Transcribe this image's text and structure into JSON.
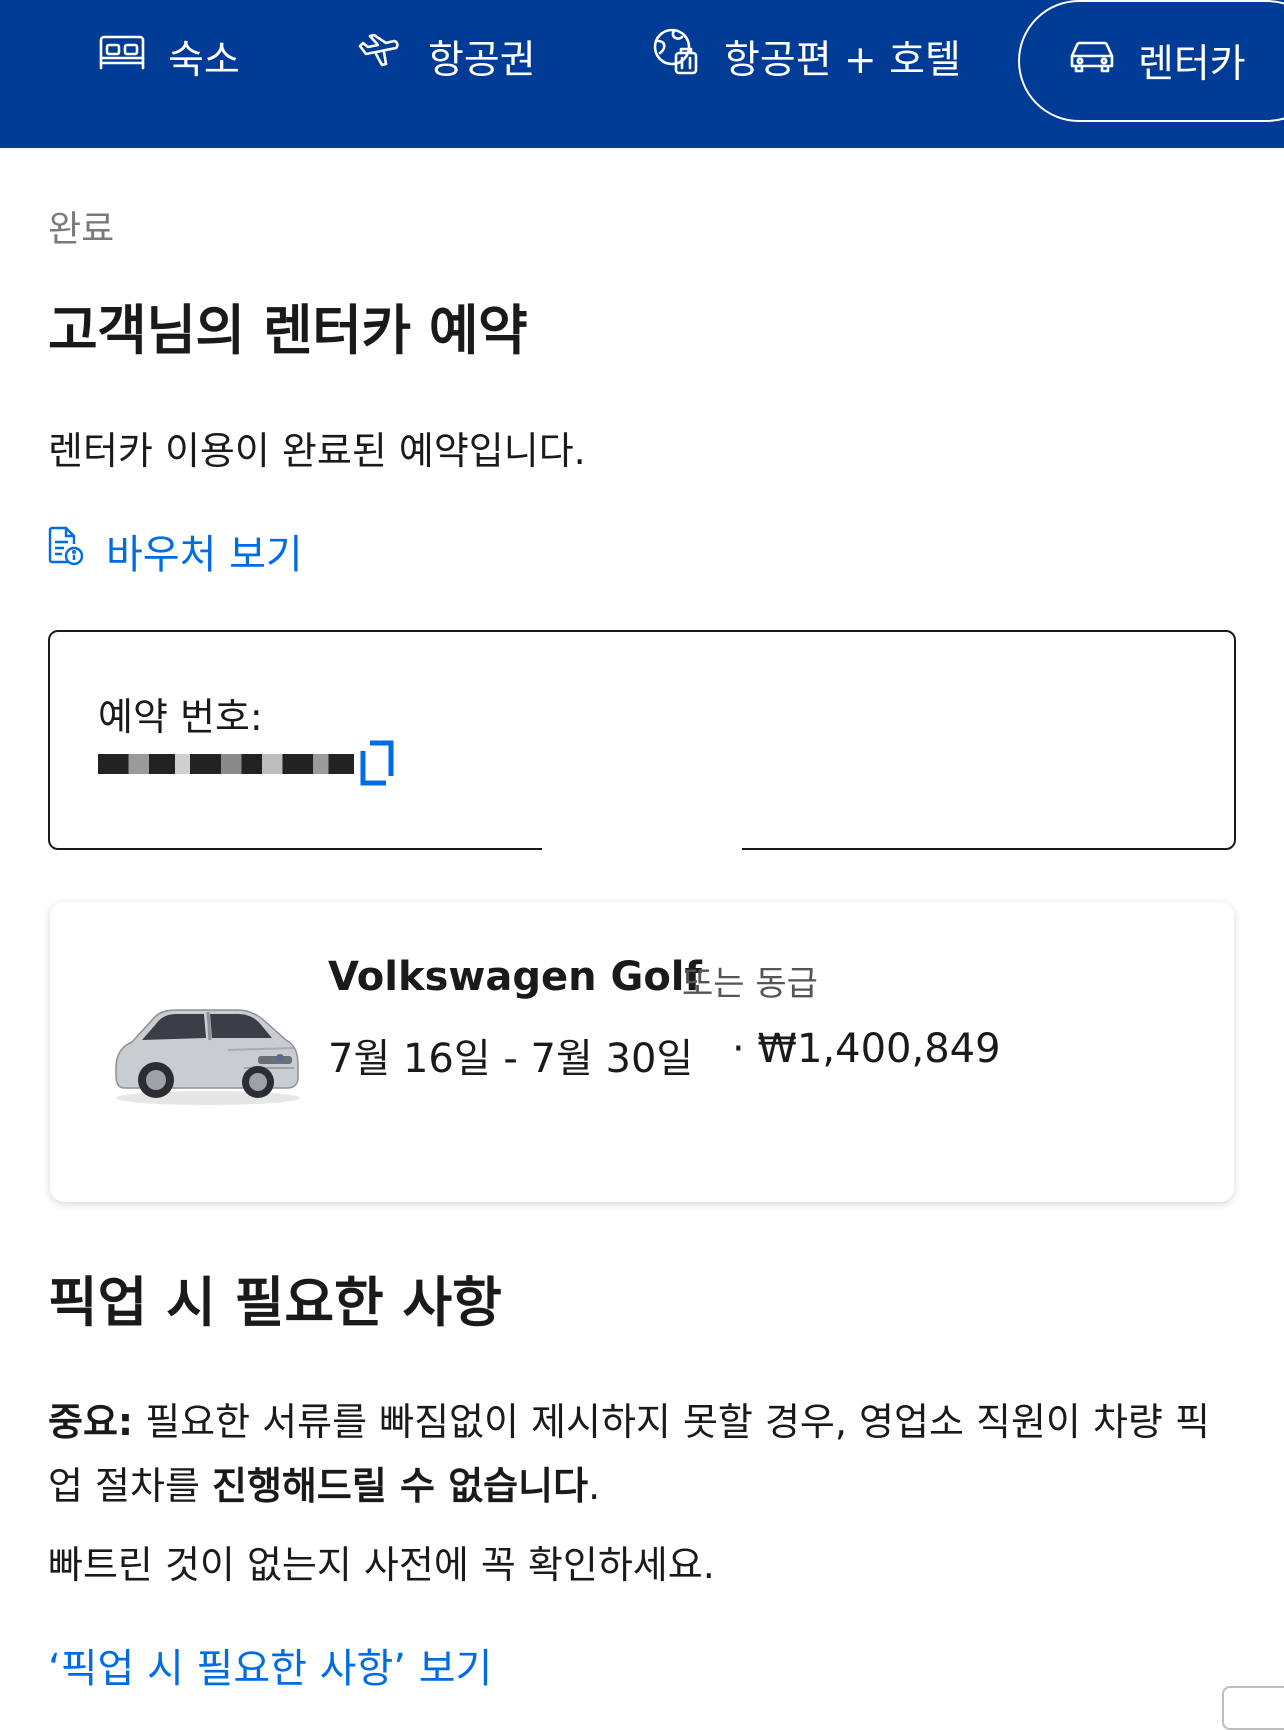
{
  "nav": {
    "items": [
      {
        "label": "숙소",
        "icon": "bed-icon"
      },
      {
        "label": "항공권",
        "icon": "airplane-icon"
      },
      {
        "label": "항공편 + 호텔",
        "icon": "globe-luggage-icon"
      },
      {
        "label": "렌터카",
        "icon": "car-icon",
        "active": true
      }
    ]
  },
  "breadcrumb": "완료",
  "page_title": "고객님의 렌터카 예약",
  "subtitle": "렌터카 이용이 완료된 예약입니다.",
  "voucher_link": "바우처 보기",
  "booking": {
    "label": "예약 번호:",
    "number_redacted": true
  },
  "car": {
    "name": "Volkswagen Golf",
    "or_similar": "또는 동급",
    "dates": "7월 16일 -  7월 30일",
    "price": "· ₩1,400,849"
  },
  "requirements": {
    "title": "픽업 시 필요한 사항",
    "important_label": "중요:",
    "notice_text_1": " 필요한 서류를 빠짐없이 제시하지 못할 경우, 영업소 직원이 차량 픽업 절차를 ",
    "notice_bold": "진행해드릴 수 없습니다",
    "notice_text_2": ".",
    "reminder": "빠트린 것이 없는지 사전에 꼭 확인하세요.",
    "link": "‘픽업 시 필요한 사항’ 보기"
  },
  "colors": {
    "nav_bg": "#003b95",
    "link": "#006ce4",
    "text": "#1a1a1a",
    "muted": "#7a7a7a"
  }
}
